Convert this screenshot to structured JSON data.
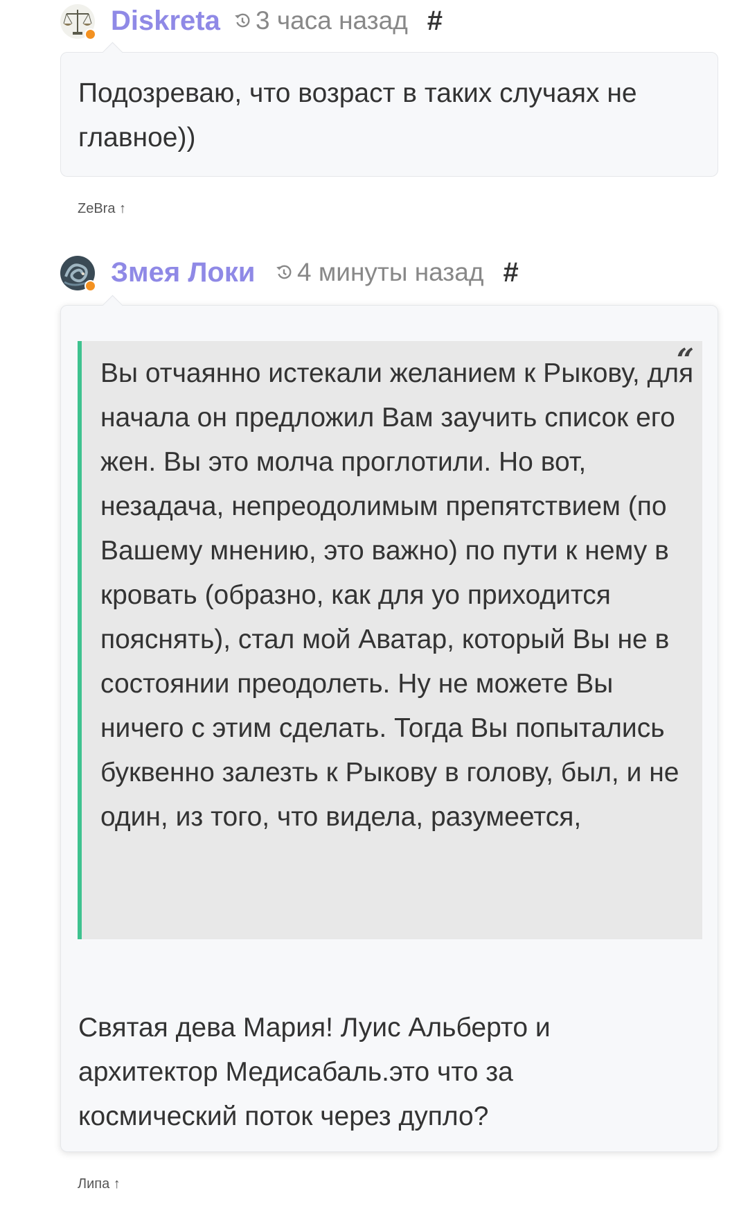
{
  "comments": [
    {
      "author": "Diskreta",
      "time": "3 часа назад",
      "hash": "#",
      "text": "Подозреваю, что возраст в таких случаях не главное))",
      "reply_to": "ZeBra ↑"
    },
    {
      "author": "Змея Локи",
      "time": "4 минуты назад",
      "hash": "#",
      "quote_mark": "“",
      "quote": "Вы отчаянно истекали желанием к Рыкову, для начала он предложил Вам заучить список его жен. Вы это молча проглотили. Но вот, незадача, непреодолимым препятствием (по Вашему мнению, это важно) по пути к нему в кровать (образно, как для уо приходится пояснять), стал мой Аватар, который Вы не в состоянии преодолеть. Ну не можете Вы ничего с этим сделать. Тогда Вы попытались буквенно залезть к Рыкову в голову, был, и не один, из того, что видела, разумеется,",
      "text": "Святая дева Мария! Луис Альберто и архитектор Медисабаль.это что за космический поток через дупло?",
      "reply_to": "Липа ↑"
    }
  ],
  "colors": {
    "author": "#8f89e6",
    "online": "#f39121",
    "quote_border": "#3ec28f",
    "quote_bg": "#e8e8e8",
    "card_bg": "#f7f8fa"
  },
  "icons": [
    "history-icon",
    "quote-icon",
    "avatar-scales",
    "avatar-snake"
  ]
}
